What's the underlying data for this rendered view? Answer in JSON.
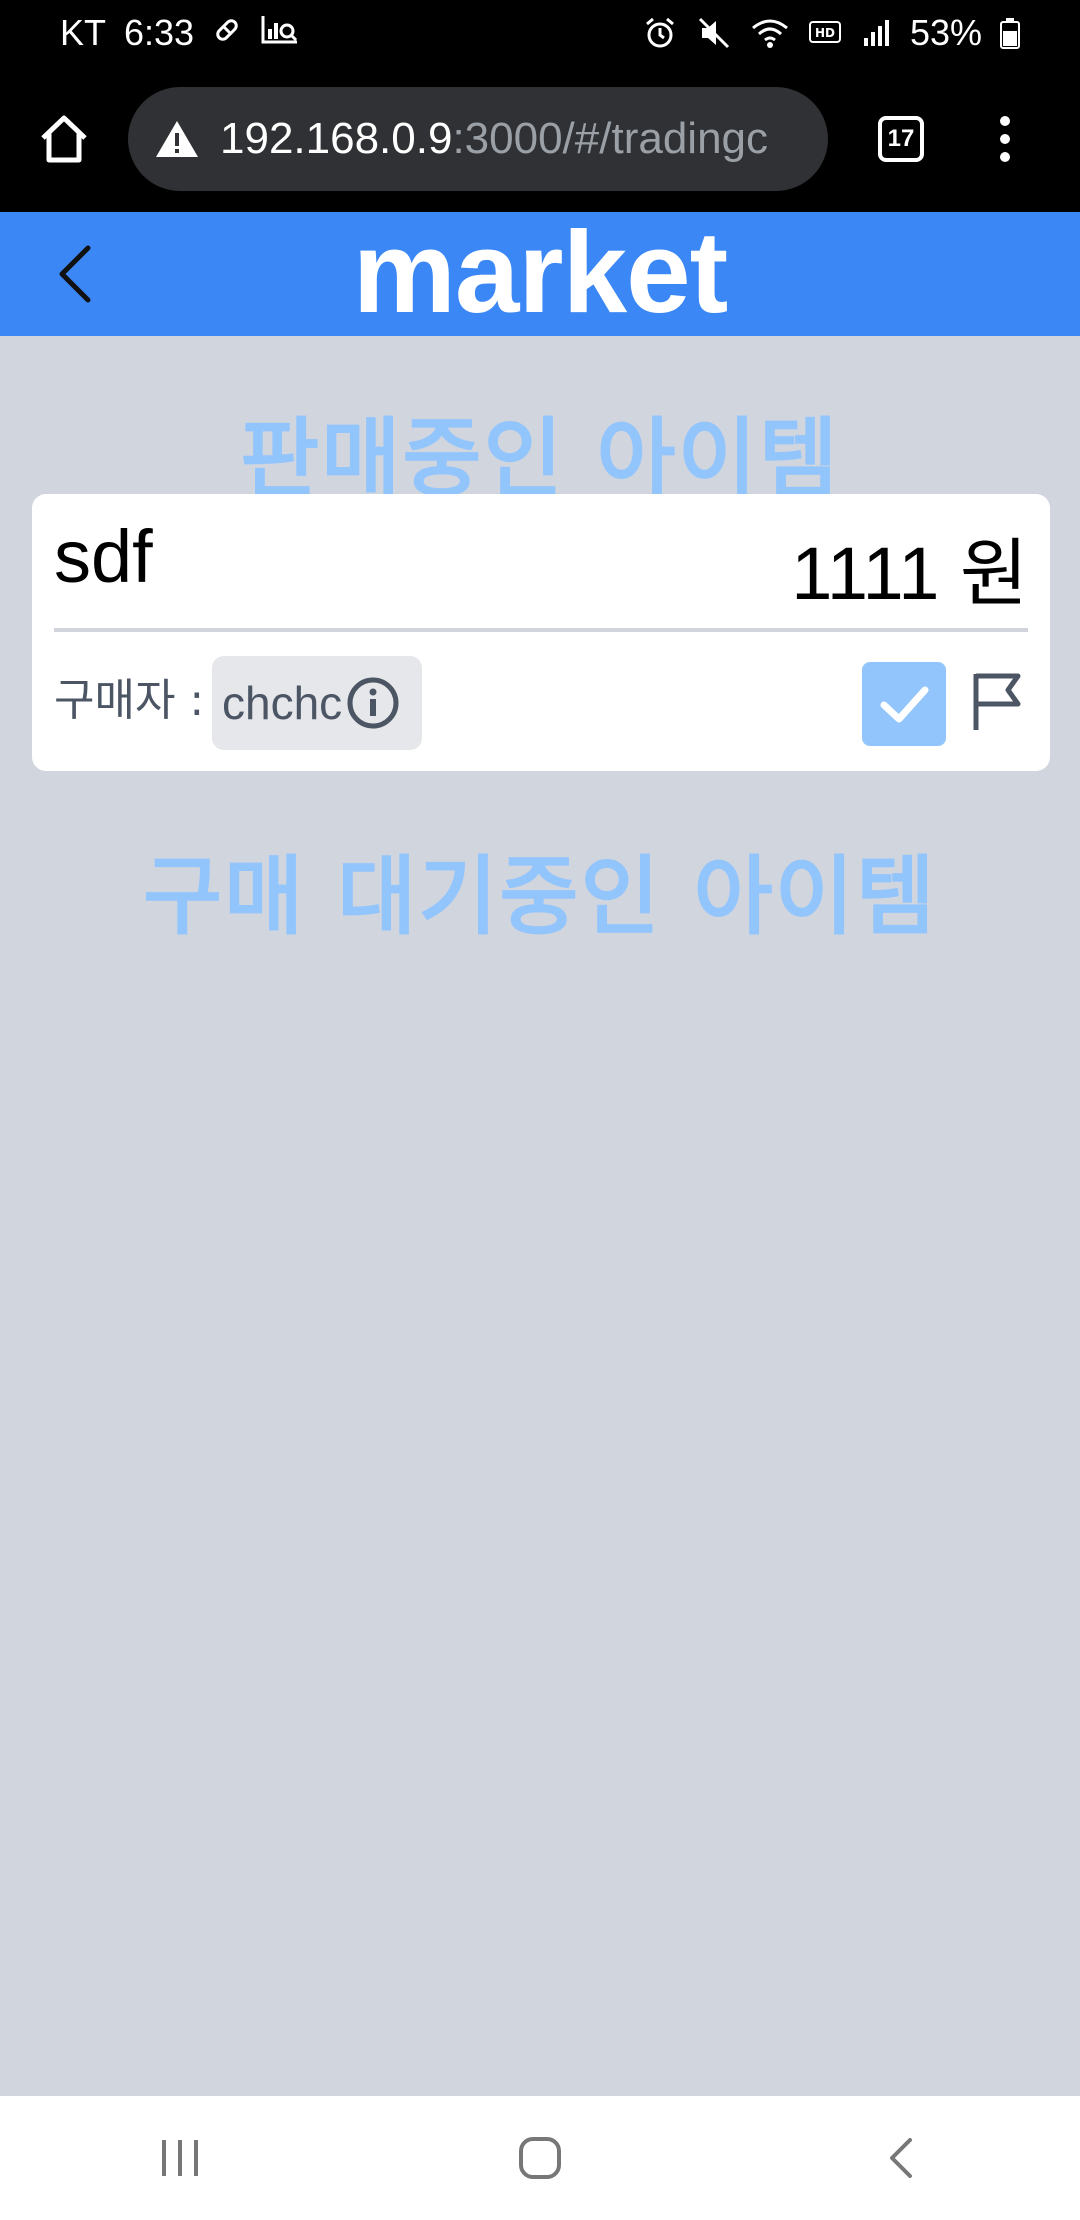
{
  "status_bar": {
    "carrier": "KT",
    "time": "6:33",
    "battery": "53%"
  },
  "browser": {
    "url_host": "192.168.0.9",
    "url_path": ":3000/#/tradingc",
    "tab_count": "17"
  },
  "header": {
    "title": "market"
  },
  "sections": {
    "selling_title": "판매중인 아이템",
    "pending_title": "구매 대기중인 아이템"
  },
  "items": [
    {
      "name": "sdf",
      "price": "1111 원",
      "buyer_label": "구매자 :",
      "buyer": "chchc",
      "checked": true
    }
  ],
  "colors": {
    "header_bg": "#3b87f5",
    "section_title": "#93c5fd",
    "page_bg": "#d1d5de"
  },
  "icons": {
    "home": "home-icon",
    "warning": "warning-icon",
    "back": "chevron-left-icon",
    "info": "info-icon",
    "check": "check-icon",
    "flag": "flag-icon"
  }
}
